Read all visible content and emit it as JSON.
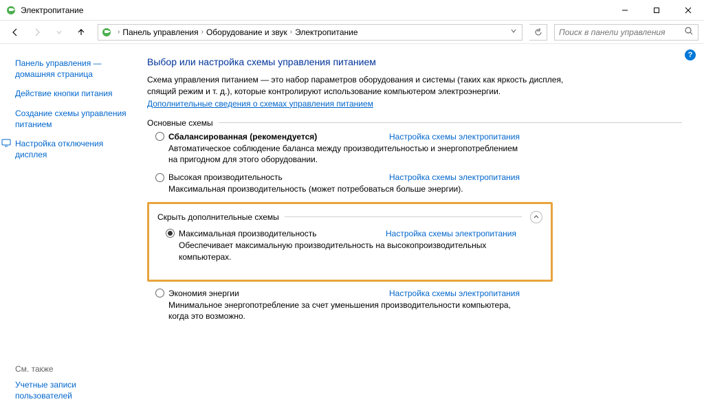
{
  "window": {
    "title": "Электропитание"
  },
  "breadcrumb": {
    "items": [
      "Панель управления",
      "Оборудование и звук",
      "Электропитание"
    ]
  },
  "search": {
    "placeholder": "Поиск в панели управления"
  },
  "sidebar": {
    "home": "Панель управления — домашняя страница",
    "links": [
      "Действие кнопки питания",
      "Создание схемы управления питанием",
      "Настройка отключения дисплея"
    ],
    "see_also_label": "См. также",
    "see_also_links": [
      "Учетные записи пользователей"
    ]
  },
  "main": {
    "heading": "Выбор или настройка схемы управления питанием",
    "intro": "Схема управления питанием — это набор параметров оборудования и системы (таких как яркость дисплея, спящий режим и т. д.), которые контролируют использование компьютером электроэнергии.",
    "intro_link": "Дополнительные сведения о схемах управления питанием",
    "primary_label": "Основные схемы",
    "settings_link": "Настройка схемы электропитания",
    "plans": {
      "balanced": {
        "name": "Сбалансированная (рекомендуется)",
        "desc": "Автоматическое соблюдение баланса между производительностью и энергопотреблением на пригодном для этого оборудовании."
      },
      "high": {
        "name": "Высокая производительность",
        "desc": "Максимальная производительность (может потребоваться больше энергии)."
      },
      "hidden_label": "Скрыть дополнительные схемы",
      "max": {
        "name": "Максимальная производительность",
        "desc": "Обеспечивает максимальную производительность на высокопроизводительных компьютерах."
      },
      "saver": {
        "name": "Экономия энергии",
        "desc": "Минимальное энергопотребление за счет уменьшения производительности компьютера, когда это возможно."
      }
    }
  }
}
